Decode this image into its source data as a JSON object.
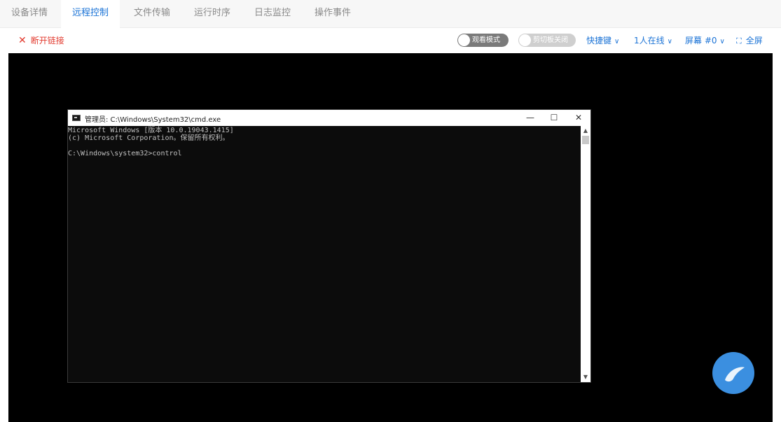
{
  "tabs": [
    {
      "label": "设备详情",
      "active": false
    },
    {
      "label": "远程控制",
      "active": true
    },
    {
      "label": "文件传输",
      "active": false
    },
    {
      "label": "运行时序",
      "active": false
    },
    {
      "label": "日志监控",
      "active": false
    },
    {
      "label": "操作事件",
      "active": false
    }
  ],
  "toolbar": {
    "disconnect_icon": "close-icon",
    "disconnect_label": "断开链接",
    "view_mode_label": "观看模式",
    "clipboard_label": "剪切板关闭",
    "shortcuts_label": "快捷键",
    "online_label": "1人在线",
    "screen_label": "屏幕 #0",
    "fullscreen_icon": "expand-icon",
    "fullscreen_label": "全屏"
  },
  "cmd_window": {
    "title": "管理员: C:\\Windows\\System32\\cmd.exe",
    "minimize": "—",
    "maximize": "☐",
    "close": "✕",
    "lines": [
      "Microsoft Windows [版本 10.0.19043.1415]",
      "(c) Microsoft Corporation。保留所有权利。",
      "",
      "C:\\Windows\\system32>control"
    ]
  },
  "colors": {
    "accent": "#1b73d6",
    "danger": "#e23a2e",
    "screen_bg": "#000000",
    "console_bg": "#0c0c0c",
    "fab": "#3b8fe0"
  }
}
